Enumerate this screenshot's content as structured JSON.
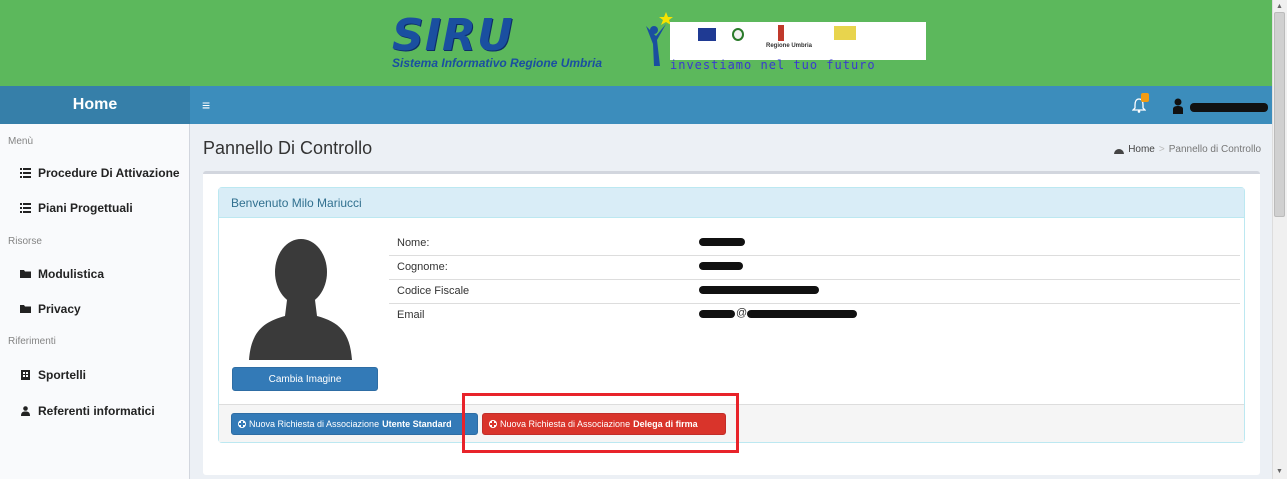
{
  "banner": {
    "logo_title": "SIRU",
    "logo_subtitle": "Sistema Informativo Regione Umbria",
    "partner_region": "Regione Umbria",
    "slogan": "investiamo nel tuo futuro",
    "background_color": "#5cb85c"
  },
  "navbar": {
    "home_label": "Home",
    "menu_icon": "≡",
    "notification_icon": "bell-icon",
    "user_icon": "user-icon",
    "background_color": "#3c8dbc"
  },
  "sidebar": {
    "sections": [
      {
        "header": "Menù",
        "items": [
          {
            "label": "Procedure Di Attivazione",
            "icon": "list-icon"
          },
          {
            "label": "Piani Progettuali",
            "icon": "list-icon"
          }
        ]
      },
      {
        "header": "Risorse",
        "items": [
          {
            "label": "Modulistica",
            "icon": "folder-icon"
          },
          {
            "label": "Privacy",
            "icon": "folder-icon"
          }
        ]
      },
      {
        "header": "Riferimenti",
        "items": [
          {
            "label": "Sportelli",
            "icon": "building-icon"
          },
          {
            "label": "Referenti informatici",
            "icon": "user-icon"
          }
        ]
      }
    ]
  },
  "page": {
    "title": "Pannello Di Controllo",
    "breadcrumb": {
      "home": "Home",
      "current": "Pannello di Controllo"
    }
  },
  "panel": {
    "heading": "Benvenuto Milo Mariucci",
    "change_image_label": "Cambia Imagine",
    "fields": [
      {
        "label": "Nome:"
      },
      {
        "label": "Cognome:"
      },
      {
        "label": "Codice Fiscale"
      },
      {
        "label": "Email",
        "value_fragment": "@"
      }
    ],
    "buttons": {
      "standard_prefix": "Nuova Richiesta di Associazione ",
      "standard_bold": "Utente Standard",
      "delega_prefix": "Nuova Richiesta di Associazione ",
      "delega_bold": "Delega di firma"
    }
  },
  "colors": {
    "primary": "#337ab7",
    "danger": "#d9342b",
    "highlight": "#e8232a",
    "panel_heading": "#d9edf7"
  }
}
